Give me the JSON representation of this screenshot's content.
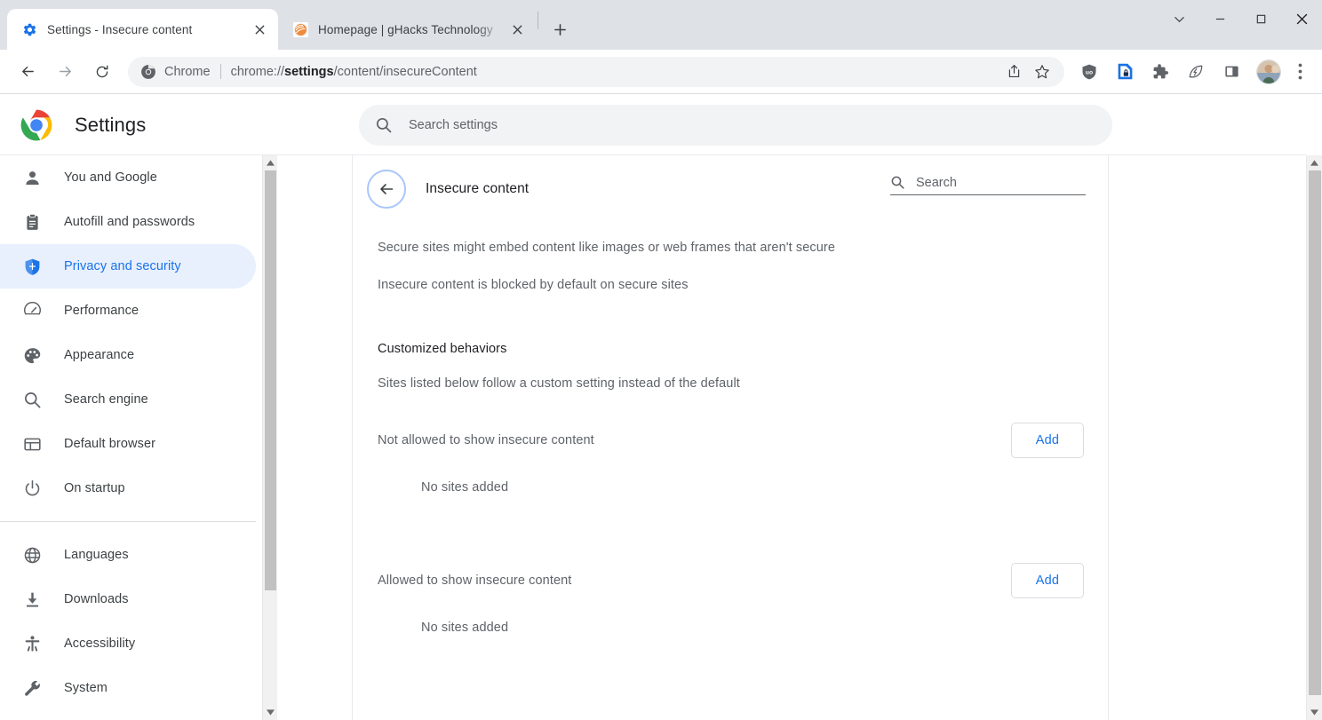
{
  "window": {
    "controls": [
      {
        "name": "tab-search",
        "glyph": "chevron-down"
      },
      {
        "name": "minimize",
        "glyph": "minus"
      },
      {
        "name": "maximize",
        "glyph": "square"
      },
      {
        "name": "close",
        "glyph": "cross"
      }
    ]
  },
  "tabs": [
    {
      "title": "Settings - Insecure content",
      "favicon": "gear-icon-blue",
      "active": true
    },
    {
      "title": "Homepage | gHacks Technology ",
      "favicon": "ghacks-swirl-icon",
      "active": false
    }
  ],
  "newtab": {
    "label": "+",
    "tooltip": "New Tab"
  },
  "omnibox": {
    "scheme_label": "Chrome",
    "url_prefix": "chrome://",
    "url_bold": "settings",
    "url_suffix": "/content/insecureContent",
    "icons_right": [
      "share-icon",
      "bookmark-star-icon"
    ]
  },
  "toolbar_extensions": [
    {
      "name": "ublock-origin-icon",
      "color": "#5f6368"
    },
    {
      "name": "page-lock-extension-icon",
      "color": "#1a73e8"
    },
    {
      "name": "puzzle-extensions-icon",
      "color": "#5f6368"
    },
    {
      "name": "eco-leaf-icon",
      "color": "#5f6368"
    },
    {
      "name": "side-panel-icon",
      "color": "#5f6368"
    },
    {
      "name": "profile-avatar",
      "color": "#b9a389"
    },
    {
      "name": "three-dot-menu-icon",
      "color": "#5f6368"
    }
  ],
  "settings_header": {
    "logo": "chrome-logo",
    "title": "Settings",
    "search_placeholder": "Search settings",
    "search_icon": "search-icon"
  },
  "sidebar": {
    "items": [
      {
        "label": "You and Google",
        "icon": "person-icon",
        "active": false
      },
      {
        "label": "Autofill and passwords",
        "icon": "clipboard-icon",
        "active": false
      },
      {
        "label": "Privacy and security",
        "icon": "shield-icon",
        "active": true
      },
      {
        "label": "Performance",
        "icon": "speedometer-icon",
        "active": false
      },
      {
        "label": "Appearance",
        "icon": "palette-icon",
        "active": false
      },
      {
        "label": "Search engine",
        "icon": "search-icon",
        "active": false
      },
      {
        "label": "Default browser",
        "icon": "browser-window-icon",
        "active": false
      },
      {
        "label": "On startup",
        "icon": "power-icon",
        "active": false
      }
    ],
    "items_after_divider": [
      {
        "label": "Languages",
        "icon": "globe-icon",
        "active": false
      },
      {
        "label": "Downloads",
        "icon": "download-icon",
        "active": false
      },
      {
        "label": "Accessibility",
        "icon": "accessibility-icon",
        "active": false
      },
      {
        "label": "System",
        "icon": "wrench-icon",
        "active": false
      }
    ]
  },
  "main": {
    "back_icon": "arrow-left-icon",
    "title": "Insecure content",
    "search": {
      "icon": "search-icon",
      "placeholder": "Search"
    },
    "description_line_1": "Secure sites might embed content like images or web frames that aren't secure",
    "description_line_2": "Insecure content is blocked by default on secure sites",
    "customized_title": "Customized behaviors",
    "customized_subtitle": "Sites listed below follow a custom setting instead of the default",
    "permission_groups": [
      {
        "label": "Not allowed to show insecure content",
        "add_label": "Add",
        "empty_label": "No sites added"
      },
      {
        "label": "Allowed to show insecure content",
        "add_label": "Add",
        "empty_label": "No sites added"
      }
    ]
  },
  "colors": {
    "accent_blue": "#1a73e8",
    "active_sidebar_bg": "#e8f0fe",
    "tabstrip_bg": "#dee1e6",
    "text_primary": "#202124",
    "text_secondary": "#5f6368"
  }
}
